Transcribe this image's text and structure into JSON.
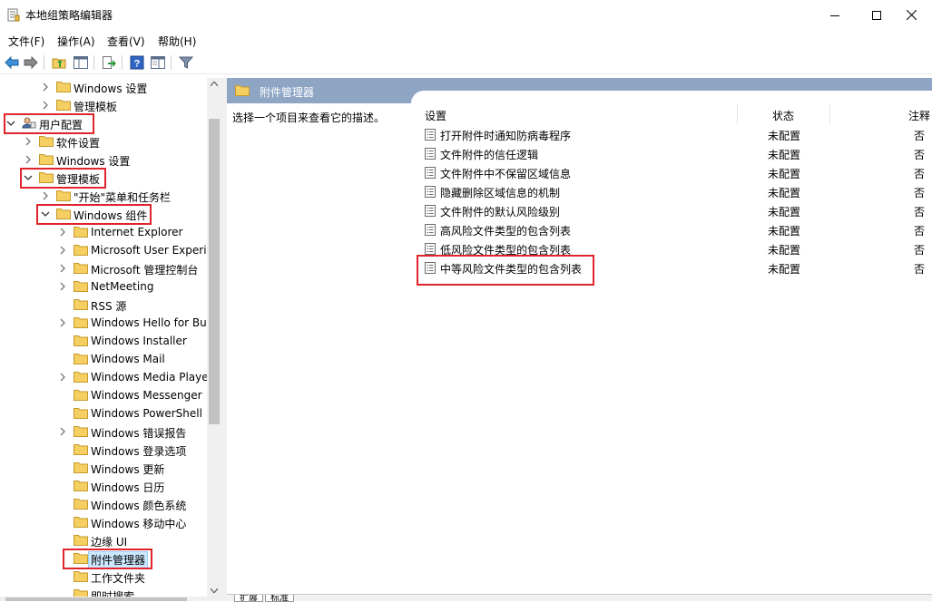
{
  "window": {
    "title": "本地组策略编辑器"
  },
  "menu": [
    "文件(F)",
    "操作(A)",
    "查看(V)",
    "帮助(H)"
  ],
  "toolbar": {
    "icons": [
      "back-arrow-icon",
      "forward-arrow-icon",
      "up-folder-icon",
      "show-hide-tree-icon",
      "export-list-icon",
      "help-icon",
      "extended-view-icon",
      "filter-icon"
    ]
  },
  "tree": [
    {
      "label": "Windows 设置",
      "level": 2,
      "expandable": true,
      "expanded": false
    },
    {
      "label": "管理模板",
      "level": 2,
      "expandable": true,
      "expanded": false
    },
    {
      "label": "用户配置",
      "level": 0,
      "expandable": true,
      "expanded": true,
      "highlighted": true,
      "icon": "user-config-icon"
    },
    {
      "label": "软件设置",
      "level": 1,
      "expandable": true,
      "expanded": false
    },
    {
      "label": "Windows 设置",
      "level": 1,
      "expandable": true,
      "expanded": false
    },
    {
      "label": "管理模板",
      "level": 1,
      "expandable": true,
      "expanded": true,
      "highlighted": true
    },
    {
      "label": "\"开始\"菜单和任务栏",
      "level": 2,
      "expandable": true,
      "expanded": false
    },
    {
      "label": "Windows 组件",
      "level": 2,
      "expandable": true,
      "expanded": true,
      "highlighted": true
    },
    {
      "label": "Internet Explorer",
      "level": 3,
      "expandable": true
    },
    {
      "label": "Microsoft User Experi",
      "level": 3,
      "expandable": true
    },
    {
      "label": "Microsoft 管理控制台",
      "level": 3,
      "expandable": true
    },
    {
      "label": "NetMeeting",
      "level": 3,
      "expandable": true
    },
    {
      "label": "RSS 源",
      "level": 3,
      "expandable": false
    },
    {
      "label": "Windows Hello for Bu",
      "level": 3,
      "expandable": true
    },
    {
      "label": "Windows Installer",
      "level": 3,
      "expandable": false
    },
    {
      "label": "Windows Mail",
      "level": 3,
      "expandable": false
    },
    {
      "label": "Windows Media Playe",
      "level": 3,
      "expandable": true
    },
    {
      "label": "Windows Messenger",
      "level": 3,
      "expandable": false
    },
    {
      "label": "Windows PowerShell",
      "level": 3,
      "expandable": false
    },
    {
      "label": "Windows 错误报告",
      "level": 3,
      "expandable": true
    },
    {
      "label": "Windows 登录选项",
      "level": 3,
      "expandable": false
    },
    {
      "label": "Windows 更新",
      "level": 3,
      "expandable": false
    },
    {
      "label": "Windows 日历",
      "level": 3,
      "expandable": false
    },
    {
      "label": "Windows 颜色系统",
      "level": 3,
      "expandable": false
    },
    {
      "label": "Windows 移动中心",
      "level": 3,
      "expandable": false
    },
    {
      "label": "边缘 UI",
      "level": 3,
      "expandable": false
    },
    {
      "label": "附件管理器",
      "level": 3,
      "expandable": false,
      "selected": true,
      "highlighted": true
    },
    {
      "label": "工作文件夹",
      "level": 3,
      "expandable": false
    },
    {
      "label": "即时搜索",
      "level": 3,
      "expandable": false
    }
  ],
  "right": {
    "header_title": "附件管理器",
    "description": "选择一个项目来查看它的描述。",
    "columns": {
      "setting": "设置",
      "state": "状态",
      "comment": "注释"
    },
    "items": [
      {
        "name": "打开附件时通知防病毒程序",
        "state": "未配置",
        "comment": "否"
      },
      {
        "name": "文件附件的信任逻辑",
        "state": "未配置",
        "comment": "否"
      },
      {
        "name": "文件附件中不保留区域信息",
        "state": "未配置",
        "comment": "否"
      },
      {
        "name": "隐藏删除区域信息的机制",
        "state": "未配置",
        "comment": "否"
      },
      {
        "name": "文件附件的默认风险级别",
        "state": "未配置",
        "comment": "否"
      },
      {
        "name": "高风险文件类型的包含列表",
        "state": "未配置",
        "comment": "否"
      },
      {
        "name": "低风险文件类型的包含列表",
        "state": "未配置",
        "comment": "否"
      },
      {
        "name": "中等风险文件类型的包含列表",
        "state": "未配置",
        "comment": "否",
        "highlighted": true
      }
    ]
  },
  "tabs": [
    "扩展",
    "标准"
  ],
  "colors": {
    "header_bg": "#8fa5c4",
    "highlight_border": "#e0242c",
    "folder": "#f5cf62",
    "selection": "#cce8ff"
  }
}
